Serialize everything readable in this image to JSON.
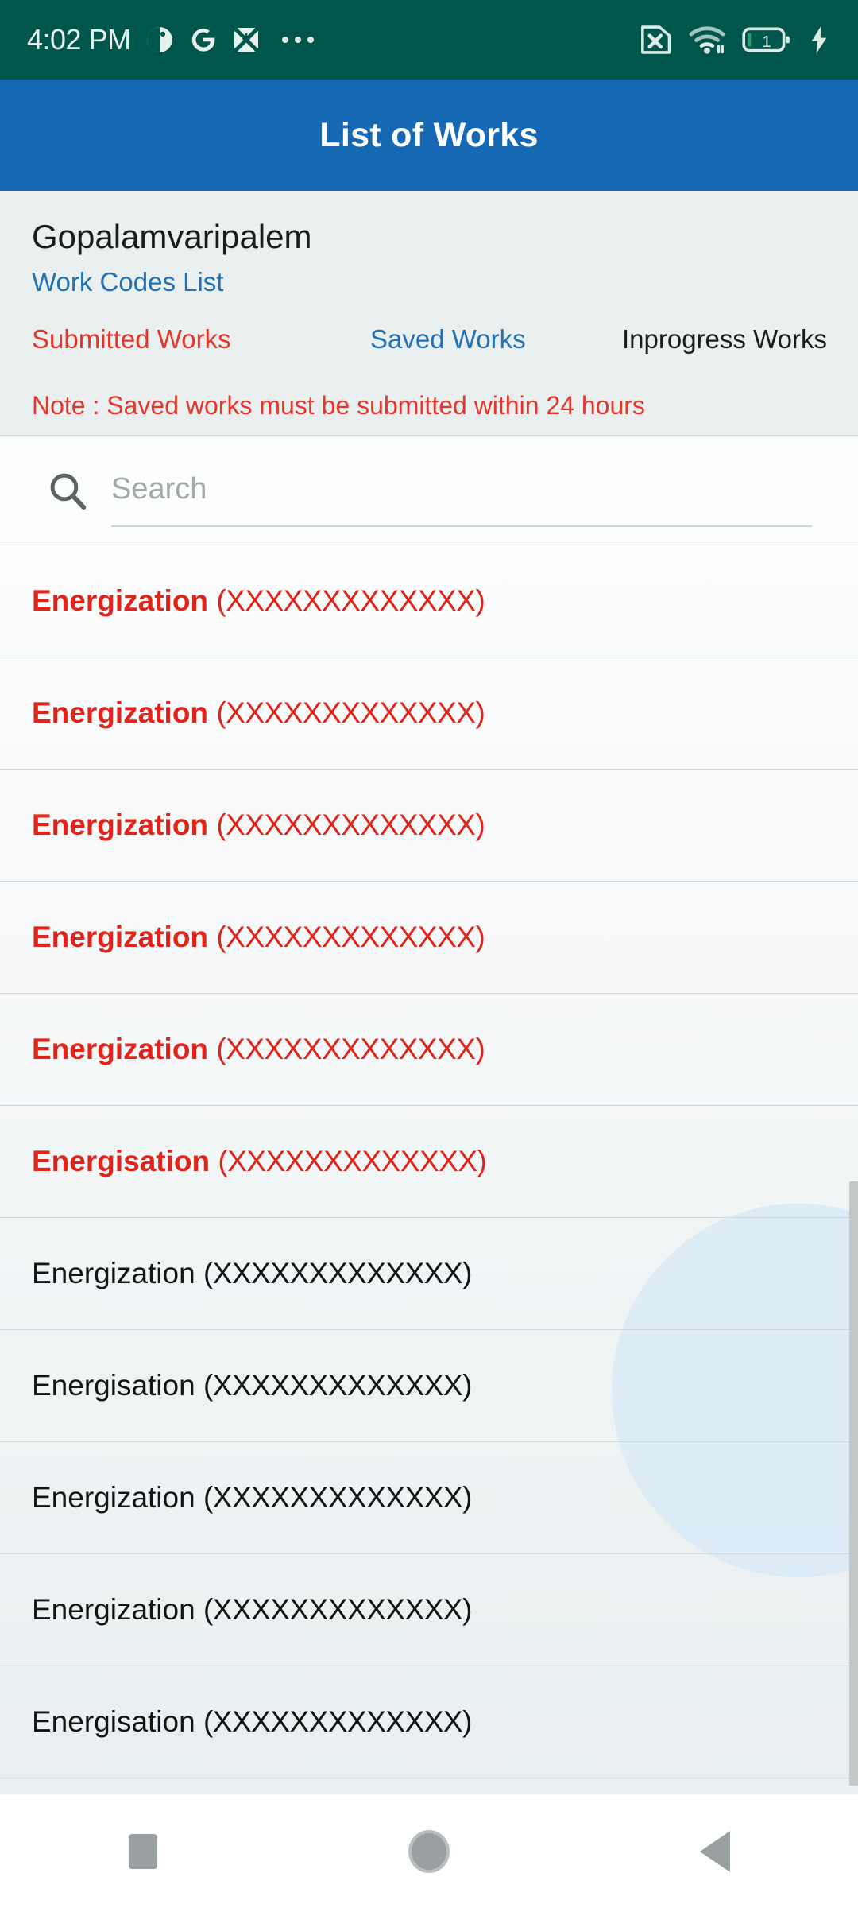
{
  "status_bar": {
    "time": "4:02 PM",
    "left_icons": [
      "clock-theme-icon",
      "google-g-icon",
      "download-file-icon",
      "more-dots-icon"
    ],
    "right_icons": [
      "no-sim-icon",
      "wifi-icon",
      "battery-icon",
      "charging-bolt-icon"
    ],
    "battery_level": "1",
    "background_color": "#00564a"
  },
  "app_bar": {
    "title": "List of Works",
    "background_color": "#1569b2"
  },
  "info": {
    "village": "Gopalamvaripalem",
    "work_codes_link": "Work Codes List",
    "note": "Note :  Saved works must be submitted within 24 hours",
    "note_color": "#e8352a"
  },
  "tabs": [
    {
      "label": "Submitted Works",
      "color": "#e8352a",
      "active": true
    },
    {
      "label": "Saved Works",
      "color": "#2272b5",
      "active": false
    },
    {
      "label": "Inprogress Works",
      "color": "#1b1b1b",
      "active": false
    }
  ],
  "search": {
    "placeholder": "Search",
    "value": "",
    "icon": "search-icon"
  },
  "list": {
    "items": [
      {
        "lead": "Energization",
        "code": "(XXXXXXXXXXXXX)",
        "color": "red"
      },
      {
        "lead": "Energization",
        "code": "(XXXXXXXXXXXXX)",
        "color": "red"
      },
      {
        "lead": "Energization",
        "code": "(XXXXXXXXXXXXX)",
        "color": "red"
      },
      {
        "lead": "Energization",
        "code": "(XXXXXXXXXXXXX)",
        "color": "red"
      },
      {
        "lead": "Energization",
        "code": "(XXXXXXXXXXXXX)",
        "color": "red"
      },
      {
        "lead": "Energisation",
        "code": "(XXXXXXXXXXXXX)",
        "color": "red"
      },
      {
        "lead": "Energization",
        "code": "(XXXXXXXXXXXXX)",
        "color": "black"
      },
      {
        "lead": "Energisation",
        "code": "(XXXXXXXXXXXXX)",
        "color": "black"
      },
      {
        "lead": "Energization",
        "code": "(XXXXXXXXXXXXX)",
        "color": "black"
      },
      {
        "lead": "Energization",
        "code": "(XXXXXXXXXXXXX)",
        "color": "black"
      },
      {
        "lead": "Energisation",
        "code": "(XXXXXXXXXXXXX)",
        "color": "black"
      }
    ],
    "red_color": "#e2231a",
    "black_color": "#141414"
  },
  "nav_bar": {
    "buttons": [
      {
        "name": "recents-square-icon"
      },
      {
        "name": "home-circle-icon"
      },
      {
        "name": "back-triangle-icon"
      }
    ]
  }
}
